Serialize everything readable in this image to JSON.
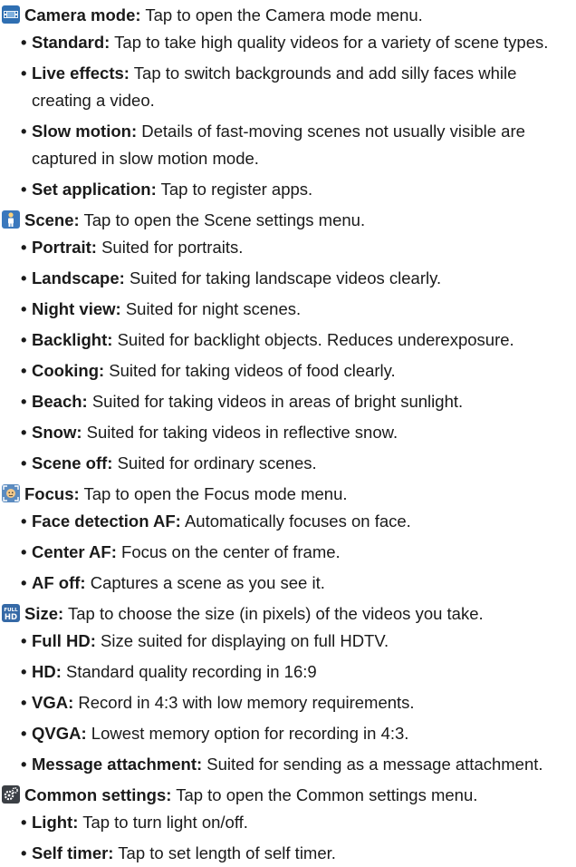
{
  "sections": [
    {
      "icon": "camera-mode-icon",
      "title": "Camera mode:",
      "desc": "Tap to open the Camera mode menu.",
      "items": [
        {
          "term": "Standard:",
          "desc": "Tap to take high quality videos for a variety of scene types."
        },
        {
          "term": "Live effects:",
          "desc": "Tap to switch backgrounds and add silly faces while creating a video."
        },
        {
          "term": "Slow motion:",
          "desc": "Details of fast-moving scenes not usually visible are captured in slow motion mode."
        },
        {
          "term": "Set application:",
          "desc": "Tap to register apps."
        }
      ]
    },
    {
      "icon": "scene-person-icon",
      "title": "Scene:",
      "desc": "Tap to open the Scene settings menu.",
      "items": [
        {
          "term": "Portrait:",
          "desc": "Suited for portraits."
        },
        {
          "term": "Landscape:",
          "desc": "Suited for taking landscape videos clearly."
        },
        {
          "term": "Night view:",
          "desc": "Suited for night scenes."
        },
        {
          "term": "Backlight:",
          "desc": "Suited for backlight objects. Reduces underexposure."
        },
        {
          "term": "Cooking:",
          "desc": "Suited for taking videos of food clearly."
        },
        {
          "term": "Beach:",
          "desc": "Suited for taking videos in areas of bright sunlight."
        },
        {
          "term": "Snow:",
          "desc": "Suited for taking videos in reflective snow."
        },
        {
          "term": "Scene off:",
          "desc": "Suited for ordinary scenes."
        }
      ]
    },
    {
      "icon": "focus-face-icon",
      "title": "Focus:",
      "desc": "Tap to open the Focus mode menu.",
      "items": [
        {
          "term": "Face detection AF:",
          "desc": "Automatically focuses on face."
        },
        {
          "term": "Center AF:",
          "desc": "Focus on the center of frame."
        },
        {
          "term": "AF off:",
          "desc": "Captures a scene as you see it."
        }
      ]
    },
    {
      "icon": "full-hd-size-icon",
      "title": "Size:",
      "desc": "Tap to choose the size (in pixels) of the videos you take.",
      "items": [
        {
          "term": "Full HD:",
          "desc": "Size suited for displaying on full HDTV."
        },
        {
          "term": "HD:",
          "desc": "Standard quality recording in 16:9"
        },
        {
          "term": "VGA:",
          "desc": "Record in 4:3 with low memory requirements."
        },
        {
          "term": "QVGA:",
          "desc": "Lowest memory option for recording in 4:3."
        },
        {
          "term": "Message attachment:",
          "desc": "Suited for sending as a message attachment."
        }
      ]
    },
    {
      "icon": "common-settings-icon",
      "title": "Common settings:",
      "desc": "Tap to open the Common settings menu.",
      "items": [
        {
          "term": "Light:",
          "desc": "Tap to turn light on/off."
        },
        {
          "term": "Self timer:",
          "desc": "Tap to set length of self timer."
        }
      ]
    }
  ]
}
